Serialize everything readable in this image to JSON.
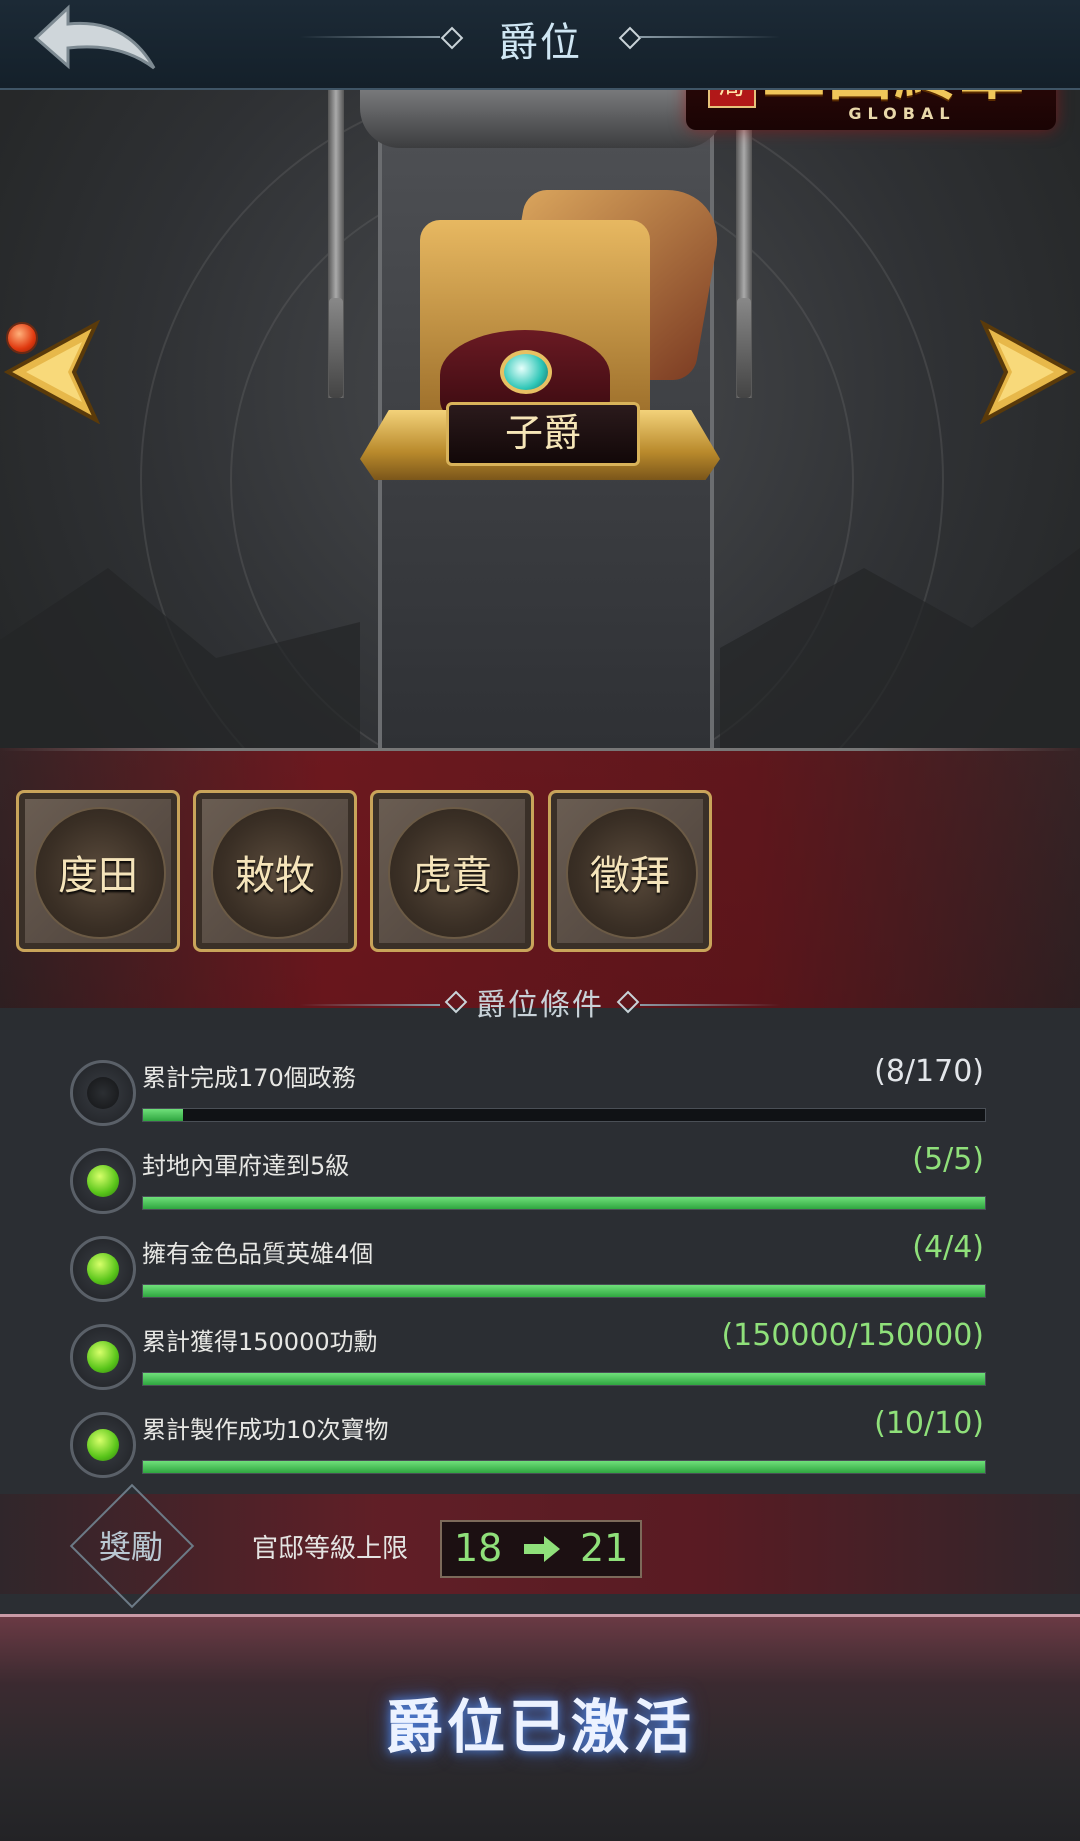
{
  "header": {
    "title": "爵位"
  },
  "hero": {
    "logo": {
      "seal": "破局",
      "main": "三國終章",
      "sub": "GLOBAL"
    },
    "rank_name": "子爵"
  },
  "skills": [
    {
      "label": "度田"
    },
    {
      "label": "敕牧"
    },
    {
      "label": "虎賁"
    },
    {
      "label": "徵拜"
    }
  ],
  "conditions_section": {
    "title": "爵位條件",
    "items": [
      {
        "text": "累計完成170個政務",
        "progress": "(8/170)",
        "fraction": 0.047,
        "done": false
      },
      {
        "text": "封地內軍府達到5級",
        "progress": "(5/5)",
        "fraction": 1.0,
        "done": true
      },
      {
        "text": "擁有金色品質英雄4個",
        "progress": "(4/4)",
        "fraction": 1.0,
        "done": true
      },
      {
        "text": "累計獲得150000功勳",
        "progress": "(150000/150000)",
        "fraction": 1.0,
        "done": true
      },
      {
        "text": "累計製作成功10次寶物",
        "progress": "(10/10)",
        "fraction": 1.0,
        "done": true
      }
    ]
  },
  "reward": {
    "label": "獎勵",
    "text": "官邸等級上限",
    "from": "18",
    "to": "21"
  },
  "footer": {
    "status": "爵位已激活"
  },
  "colors": {
    "accent_green": "#8fe07a",
    "gold": "#c9a45a",
    "crimson": "#8c121c"
  }
}
